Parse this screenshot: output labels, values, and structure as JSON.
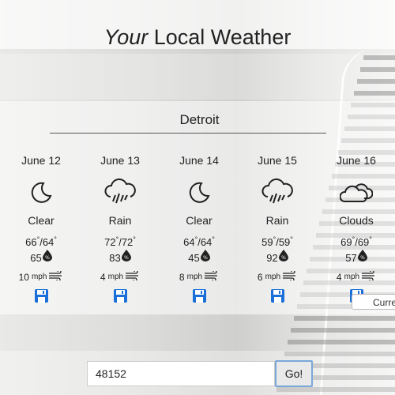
{
  "header": {
    "title_em": "Your",
    "title_rest": " Local Weather"
  },
  "city": {
    "name": "Detroit"
  },
  "forecast": [
    {
      "date": "June 12",
      "icon": "moon-icon",
      "condition": "Clear",
      "high": "66",
      "low": "64",
      "humidity": "65",
      "wind": "10",
      "wind_unit": "mph"
    },
    {
      "date": "June 13",
      "icon": "rain-cloud-icon",
      "condition": "Rain",
      "high": "72",
      "low": "72",
      "humidity": "83",
      "wind": "4",
      "wind_unit": "mph"
    },
    {
      "date": "June 14",
      "icon": "moon-icon",
      "condition": "Clear",
      "high": "64",
      "low": "64",
      "humidity": "45",
      "wind": "8",
      "wind_unit": "mph"
    },
    {
      "date": "June 15",
      "icon": "rain-cloud-icon",
      "condition": "Rain",
      "high": "59",
      "low": "59",
      "humidity": "92",
      "wind": "6",
      "wind_unit": "mph"
    },
    {
      "date": "June 16",
      "icon": "clouds-icon",
      "condition": "Clouds",
      "high": "69",
      "low": "69",
      "humidity": "57",
      "wind": "4",
      "wind_unit": "mph"
    }
  ],
  "degree_symbol": "°",
  "temp_separator": "/",
  "current_button": {
    "label": "Curre"
  },
  "search": {
    "value": "48152",
    "button_label": "Go!"
  },
  "colors": {
    "save_icon": "#1a6fd8",
    "accent_border": "#7aa7d9"
  }
}
